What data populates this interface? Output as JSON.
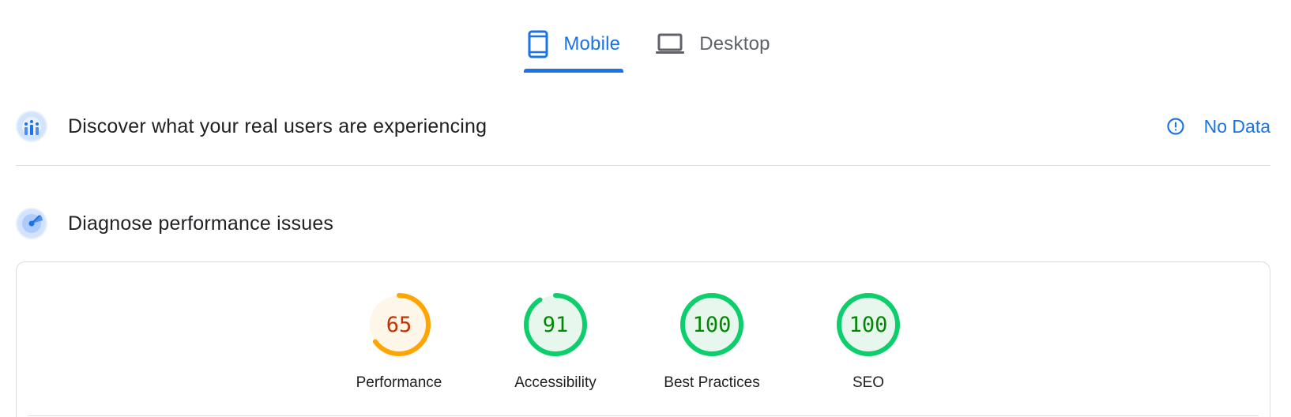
{
  "tabs": [
    {
      "label": "Mobile",
      "icon": "smartphone-icon",
      "active": true
    },
    {
      "label": "Desktop",
      "icon": "laptop-icon",
      "active": false
    }
  ],
  "field_section": {
    "title": "Discover what your real users are experiencing",
    "icon": "users-chart-icon",
    "status_label": "No Data",
    "status_icon": "info-icon"
  },
  "lab_section": {
    "title": "Diagnose performance issues",
    "icon": "radar-icon"
  },
  "scores": [
    {
      "label": "Performance",
      "value": 65,
      "status": "average"
    },
    {
      "label": "Accessibility",
      "value": 91,
      "status": "pass"
    },
    {
      "label": "Best Practices",
      "value": 100,
      "status": "pass"
    },
    {
      "label": "SEO",
      "value": 100,
      "status": "pass"
    }
  ],
  "colors": {
    "accent": "#1a73e8",
    "pass_stroke": "#0cce6b",
    "pass_fill": "#e8f7ee",
    "pass_text": "#008800",
    "average_stroke": "#ffa400",
    "average_fill": "#fff6ea",
    "average_text": "#c33300"
  }
}
